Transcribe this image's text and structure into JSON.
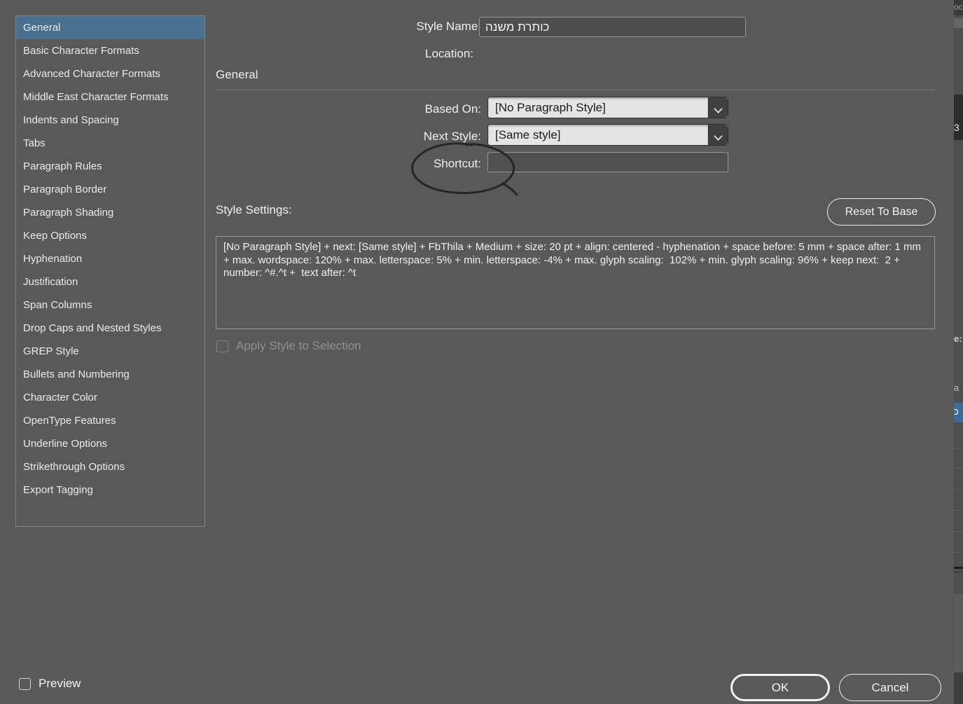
{
  "sidebar": {
    "items": [
      {
        "label": "General",
        "selected": true
      },
      {
        "label": "Basic Character Formats",
        "selected": false
      },
      {
        "label": "Advanced Character Formats",
        "selected": false
      },
      {
        "label": "Middle East Character Formats",
        "selected": false
      },
      {
        "label": "Indents and Spacing",
        "selected": false
      },
      {
        "label": "Tabs",
        "selected": false
      },
      {
        "label": "Paragraph Rules",
        "selected": false
      },
      {
        "label": "Paragraph Border",
        "selected": false
      },
      {
        "label": "Paragraph Shading",
        "selected": false
      },
      {
        "label": "Keep Options",
        "selected": false
      },
      {
        "label": "Hyphenation",
        "selected": false
      },
      {
        "label": "Justification",
        "selected": false
      },
      {
        "label": "Span Columns",
        "selected": false
      },
      {
        "label": "Drop Caps and Nested Styles",
        "selected": false
      },
      {
        "label": "GREP Style",
        "selected": false
      },
      {
        "label": "Bullets and Numbering",
        "selected": false
      },
      {
        "label": "Character Color",
        "selected": false
      },
      {
        "label": "OpenType Features",
        "selected": false
      },
      {
        "label": "Underline Options",
        "selected": false
      },
      {
        "label": "Strikethrough Options",
        "selected": false
      },
      {
        "label": "Export Tagging",
        "selected": false
      }
    ]
  },
  "dialog": {
    "style_name_label": "Style Name:",
    "style_name_value": "כותרת משנה",
    "location_label": "Location:",
    "section_title": "General",
    "based_on_label": "Based On:",
    "based_on_value": "[No Paragraph Style]",
    "next_style_label": "Next Style:",
    "next_style_value": "[Same style]",
    "shortcut_label": "Shortcut:",
    "shortcut_value": "",
    "style_settings_label": "Style Settings:",
    "reset_button_label": "Reset To Base",
    "style_settings_text": "[No Paragraph Style] + next: [Same style] + FbThila + Medium + size: 20 pt + align: centered - hyphenation + space before: 5 mm + space after: 1 mm + max. wordspace: 120% + max. letterspace: 5% + min. letterspace: -4% + max. glyph scaling:  102% + min. glyph scaling: 96% + keep next:  2 +  number: ^#.^t +  text after: ^t",
    "apply_style_label": "Apply Style to Selection",
    "apply_style_checked": false,
    "apply_style_enabled": false,
    "preview_label": "Preview",
    "preview_checked": false,
    "ok_button_label": "OK",
    "cancel_button_label": "Cancel"
  },
  "background_fragments": {
    "top_text": "oc",
    "dark_value": "3",
    "frag_e": "e:",
    "frag_a": "a",
    "frag_hebrew": "כ"
  },
  "colors": {
    "dialog_background": "#595959",
    "selected_item": "#4a708f",
    "combo_field": "#e4e4e4",
    "combo_button": "#404040",
    "annotation_ink": "#222222",
    "behind_panel_highlight": "#3e6a94"
  }
}
